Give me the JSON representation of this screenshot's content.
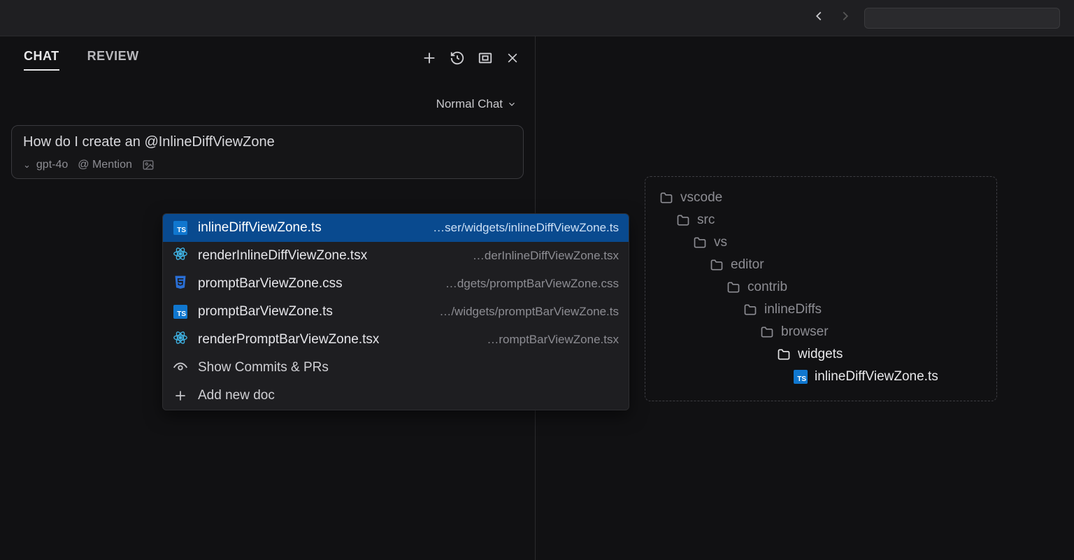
{
  "topbar": {},
  "tabs": {
    "chat": "CHAT",
    "review": "REVIEW"
  },
  "mode": {
    "label": "Normal Chat"
  },
  "chat": {
    "prefix": "How do I create an ",
    "mention": "@InlineDiffViewZone",
    "model": "gpt-4o",
    "mention_label": "@ Mention"
  },
  "suggestions": [
    {
      "icon": "ts",
      "name": "inlineDiffViewZone.ts",
      "path": "…ser/widgets/inlineDiffViewZone.ts",
      "selected": true
    },
    {
      "icon": "react",
      "name": "renderInlineDiffViewZone.tsx",
      "path": "…derInlineDiffViewZone.tsx"
    },
    {
      "icon": "css",
      "name": "promptBarViewZone.css",
      "path": "…dgets/promptBarViewZone.css"
    },
    {
      "icon": "ts",
      "name": "promptBarViewZone.ts",
      "path": "…/widgets/promptBarViewZone.ts"
    },
    {
      "icon": "react",
      "name": "renderPromptBarViewZone.tsx",
      "path": "…romptBarViewZone.tsx"
    }
  ],
  "suggestion_actions": {
    "commits": "Show Commits & PRs",
    "add_doc": "Add new doc"
  },
  "tree": [
    {
      "name": "vscode",
      "depth": 0,
      "type": "folder"
    },
    {
      "name": "src",
      "depth": 1,
      "type": "folder"
    },
    {
      "name": "vs",
      "depth": 2,
      "type": "folder"
    },
    {
      "name": "editor",
      "depth": 3,
      "type": "folder"
    },
    {
      "name": "contrib",
      "depth": 4,
      "type": "folder"
    },
    {
      "name": "inlineDiffs",
      "depth": 5,
      "type": "folder"
    },
    {
      "name": "browser",
      "depth": 6,
      "type": "folder"
    },
    {
      "name": "widgets",
      "depth": 7,
      "type": "folder",
      "active": true
    },
    {
      "name": "inlineDiffViewZone.ts",
      "depth": 8,
      "type": "file",
      "active": true
    }
  ]
}
